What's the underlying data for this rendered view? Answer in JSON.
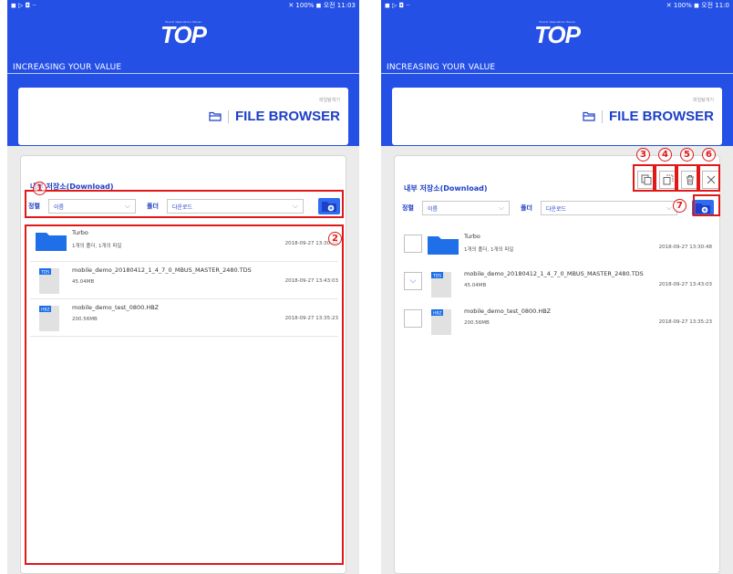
{
  "status_bar": {
    "left_icons": "◼ ▷ ◘ ··",
    "right_text": "✕ 100% ◼ 오전 11:03",
    "right_text_2": "✕ 100% ◼ 오전 11:0"
  },
  "app": {
    "logo_subtitle": "Touch Operation Panel",
    "logo": "TOP",
    "tagline": "INCREASING YOUR VALUE",
    "browser_subtitle": "파일탐색기",
    "browser_title": "FILE BROWSER"
  },
  "storage_title": "내부 저장소(Download)",
  "toolbar": {
    "sort_label": "정렬",
    "sort_value": "이름",
    "folder_label": "폴더",
    "folder_value": "다운로드"
  },
  "files": [
    {
      "type": "folder",
      "name": "Turbo",
      "meta": "1개의 폴더, 1개의 파일",
      "date": "2018-09-27 13:30:48"
    },
    {
      "type": "file",
      "ext": "TDS",
      "name": "mobile_demo_20180412_1_4_7_0_MBUS_MASTER_2480.TDS",
      "meta": "45.04MB",
      "date": "2018-09-27 13:43:03"
    },
    {
      "type": "file",
      "ext": "HBZ",
      "name": "mobile_demo_test_0800.HBZ",
      "meta": "200.56MB",
      "date": "2018-09-27 13:35:23"
    }
  ],
  "annotations": {
    "left": [
      "1",
      "2"
    ],
    "right": [
      "3",
      "4",
      "5",
      "6",
      "7"
    ]
  },
  "colors": {
    "brand_blue": "#2450e6",
    "annotation_red": "#e01818"
  },
  "icons": {
    "file_browser": "folder-outline-icon",
    "copy": "copy-icon",
    "move": "move-icon",
    "delete": "trash-icon",
    "close": "close-icon",
    "new_folder": "new-folder-icon"
  }
}
